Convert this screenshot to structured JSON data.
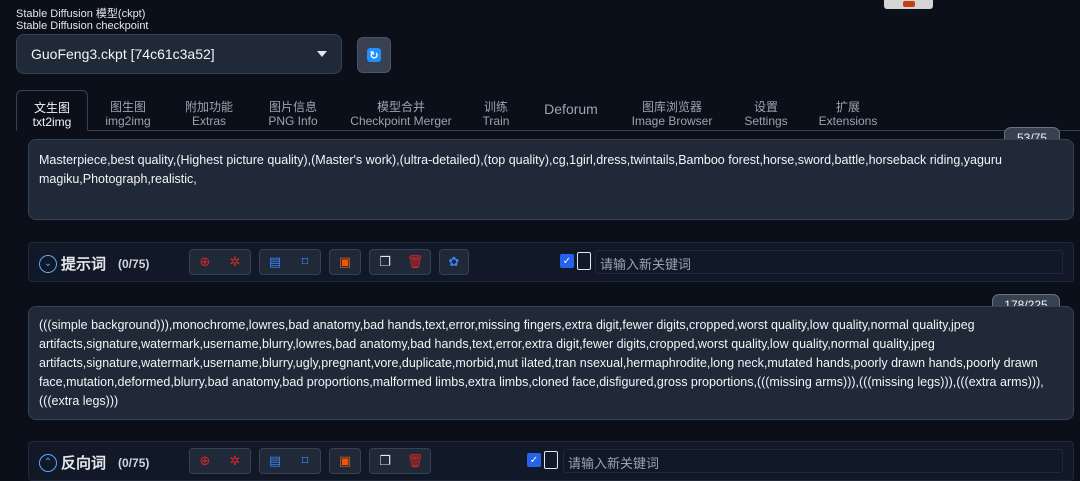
{
  "checkpoint": {
    "label_line1": "Stable Diffusion 模型(ckpt)",
    "label_line2": "Stable Diffusion checkpoint",
    "value": "GuoFeng3.ckpt [74c61c3a52]"
  },
  "tabs": [
    {
      "zh": "文生图",
      "en": "txt2img"
    },
    {
      "zh": "图生图",
      "en": "img2img"
    },
    {
      "zh": "附加功能",
      "en": "Extras"
    },
    {
      "zh": "图片信息",
      "en": "PNG Info"
    },
    {
      "zh": "模型合并",
      "en": "Checkpoint Merger"
    },
    {
      "zh": "训练",
      "en": "Train"
    },
    {
      "zh": "Deforum",
      "en": ""
    },
    {
      "zh": "图库浏览器",
      "en": "Image Browser"
    },
    {
      "zh": "设置",
      "en": "Settings"
    },
    {
      "zh": "扩展",
      "en": "Extensions"
    }
  ],
  "prompt": {
    "token_count": "53/75",
    "text": "Masterpiece,best quality,(Highest picture quality),(Master's work),(ultra-detailed),(top quality),cg,1girl,dress,twintails,Bamboo forest,horse,sword,battle,horseback riding,yaguru magiku,Photograph,realistic,"
  },
  "prompt_section": {
    "title": "提示词",
    "count": "(0/75)",
    "keyword_placeholder": "请输入新关键词"
  },
  "negative": {
    "token_count": "178/225",
    "text": "(((simple background))),monochrome,lowres,bad anatomy,bad hands,text,error,missing fingers,extra digit,fewer digits,cropped,worst quality,low quality,normal quality,jpeg artifacts,signature,watermark,username,blurry,lowres,bad anatomy,bad hands,text,error,extra digit,fewer digits,cropped,worst quality,low quality,normal quality,jpeg artifacts,signature,watermark,username,blurry,ugly,pregnant,vore,duplicate,morbid,mut ilated,tran nsexual,hermaphrodite,long neck,mutated hands,poorly drawn hands,poorly drawn face,mutation,deformed,blurry,bad anatomy,bad proportions,malformed limbs,extra limbs,cloned face,disfigured,gross proportions,(((missing arms))),(((missing legs))),(((extra arms))),(((extra legs)))"
  },
  "negative_section": {
    "title": "反向词",
    "count": "(0/75)",
    "keyword_placeholder": "请输入新关键词"
  },
  "colors": {
    "background": "#0b0f19",
    "accent": "#60a5fa",
    "red_icon": "#dc2626",
    "orange_icon": "#ea580c",
    "blue_icon": "#3b82f6"
  }
}
